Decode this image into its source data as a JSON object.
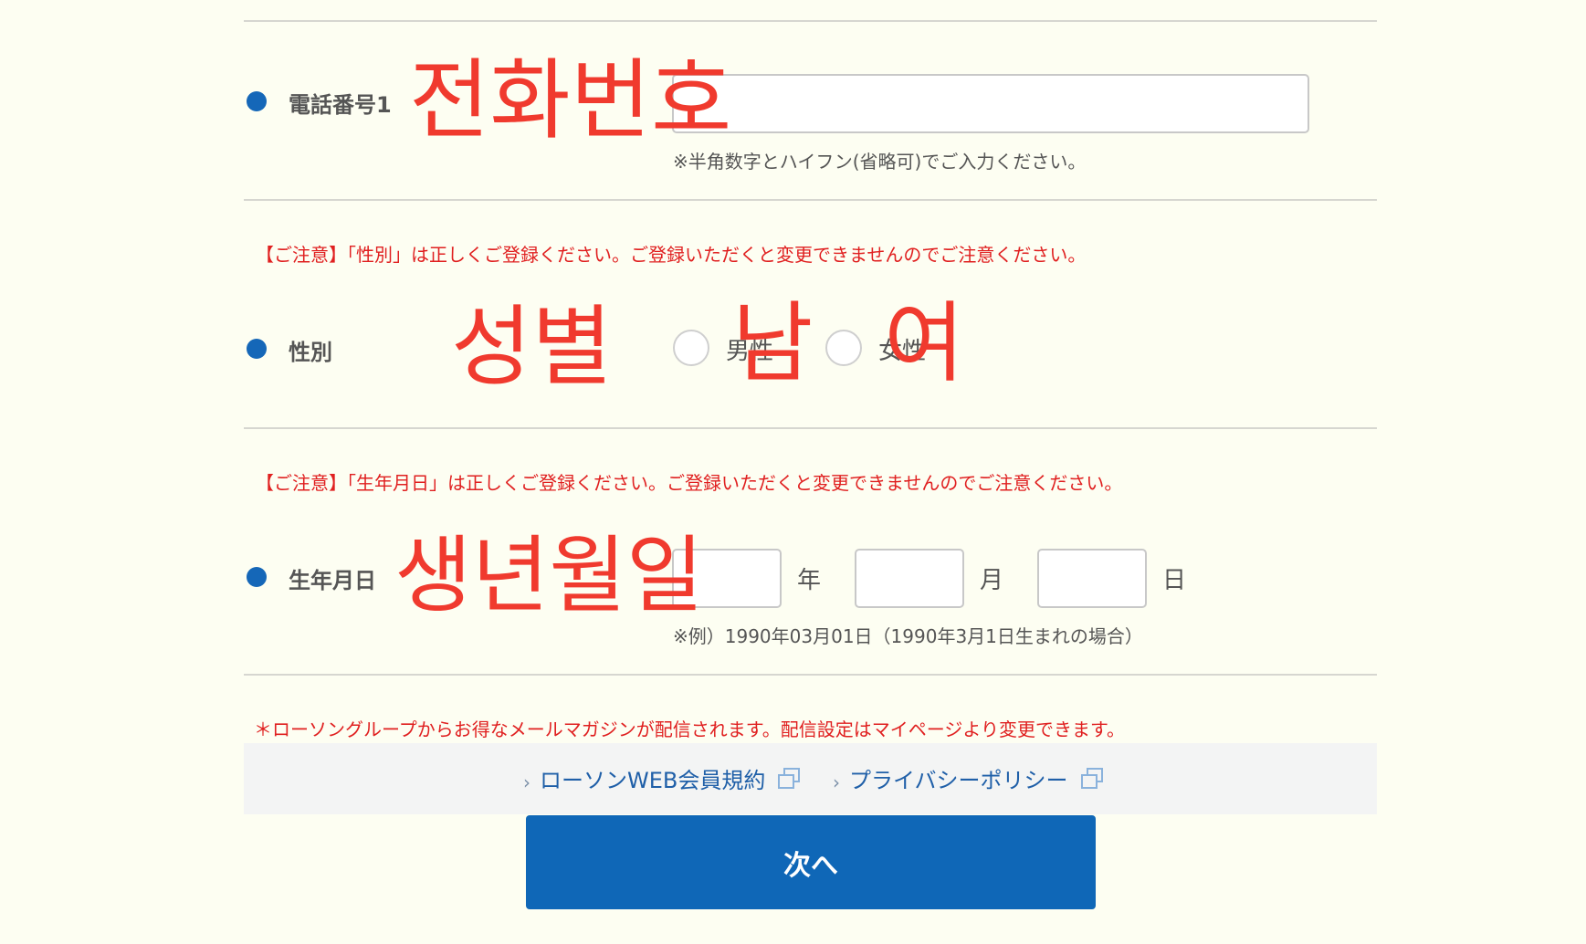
{
  "phone": {
    "label": "電話番号1",
    "overlay": "전화번호",
    "value": "",
    "hint": "※半角数字とハイフン(省略可)でご入力ください。"
  },
  "gender": {
    "notice": "【ご注意】「性別」は正しくご登録ください。ご登録いただくと変更できませんのでご注意ください。",
    "label": "性別",
    "overlay": "성별",
    "options": [
      {
        "label": "男性",
        "overlay": "남",
        "selected": false
      },
      {
        "label": "女性",
        "overlay": "여",
        "selected": false
      }
    ]
  },
  "birthdate": {
    "notice": "【ご注意】「生年月日」は正しくご登録ください。ご登録いただくと変更できませんのでご注意ください。",
    "label": "生年月日",
    "overlay": "생년월일",
    "year_unit": "年",
    "month_unit": "月",
    "day_unit": "日",
    "year_value": "",
    "month_value": "",
    "day_value": "",
    "hint": "※例）1990年03月01日（1990年3月1日生まれの場合）"
  },
  "newsletter_notice": "＊ローソングループからお得なメールマガジンが配信されます。配信設定はマイページより変更できます。",
  "links": [
    {
      "label": "ローソンWEB会員規約",
      "icon": "external-window-icon"
    },
    {
      "label": "プライバシーポリシー",
      "icon": "external-window-icon"
    }
  ],
  "next_button": {
    "label": "次へ"
  },
  "colors": {
    "accent": "#0f67b7",
    "overlay_red": "#f03a2e",
    "notice_red": "#e02020",
    "background": "#fdfef2"
  }
}
